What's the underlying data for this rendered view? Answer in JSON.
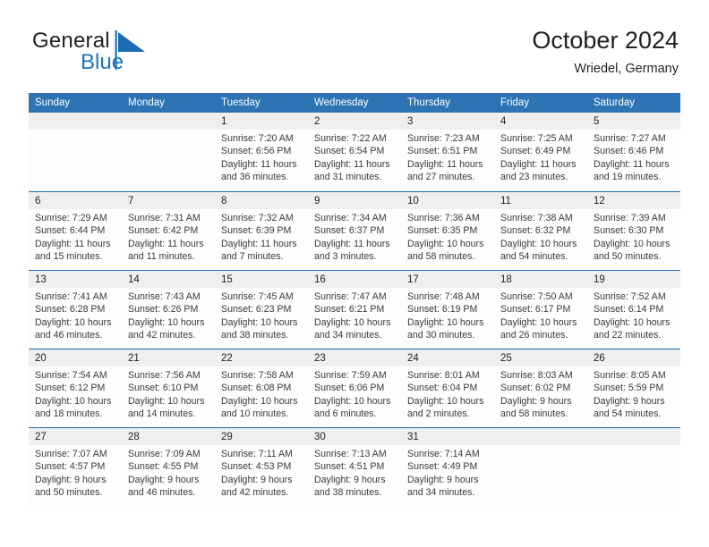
{
  "brand": {
    "name_part1": "General",
    "name_part2": "Blue",
    "logo_icon": "triangle-mark",
    "accent_color": "#1b75bb"
  },
  "header": {
    "title": "October 2024",
    "subtitle": "Wriedel, Germany"
  },
  "calendar": {
    "header_color": "#2e74b5",
    "row_divider_color": "#1f6cb0",
    "date_band_color": "#efefef",
    "weekdays": [
      "Sunday",
      "Monday",
      "Tuesday",
      "Wednesday",
      "Thursday",
      "Friday",
      "Saturday"
    ],
    "weeks": [
      [
        {
          "day": "",
          "empty": true,
          "sunrise": "",
          "sunset": "",
          "daylight_1": "",
          "daylight_2": ""
        },
        {
          "day": "",
          "empty": true,
          "sunrise": "",
          "sunset": "",
          "daylight_1": "",
          "daylight_2": ""
        },
        {
          "day": "1",
          "empty": false,
          "sunrise": "Sunrise: 7:20 AM",
          "sunset": "Sunset: 6:56 PM",
          "daylight_1": "Daylight: 11 hours",
          "daylight_2": "and 36 minutes."
        },
        {
          "day": "2",
          "empty": false,
          "sunrise": "Sunrise: 7:22 AM",
          "sunset": "Sunset: 6:54 PM",
          "daylight_1": "Daylight: 11 hours",
          "daylight_2": "and 31 minutes."
        },
        {
          "day": "3",
          "empty": false,
          "sunrise": "Sunrise: 7:23 AM",
          "sunset": "Sunset: 6:51 PM",
          "daylight_1": "Daylight: 11 hours",
          "daylight_2": "and 27 minutes."
        },
        {
          "day": "4",
          "empty": false,
          "sunrise": "Sunrise: 7:25 AM",
          "sunset": "Sunset: 6:49 PM",
          "daylight_1": "Daylight: 11 hours",
          "daylight_2": "and 23 minutes."
        },
        {
          "day": "5",
          "empty": false,
          "sunrise": "Sunrise: 7:27 AM",
          "sunset": "Sunset: 6:46 PM",
          "daylight_1": "Daylight: 11 hours",
          "daylight_2": "and 19 minutes."
        }
      ],
      [
        {
          "day": "6",
          "empty": false,
          "sunrise": "Sunrise: 7:29 AM",
          "sunset": "Sunset: 6:44 PM",
          "daylight_1": "Daylight: 11 hours",
          "daylight_2": "and 15 minutes."
        },
        {
          "day": "7",
          "empty": false,
          "sunrise": "Sunrise: 7:31 AM",
          "sunset": "Sunset: 6:42 PM",
          "daylight_1": "Daylight: 11 hours",
          "daylight_2": "and 11 minutes."
        },
        {
          "day": "8",
          "empty": false,
          "sunrise": "Sunrise: 7:32 AM",
          "sunset": "Sunset: 6:39 PM",
          "daylight_1": "Daylight: 11 hours",
          "daylight_2": "and 7 minutes."
        },
        {
          "day": "9",
          "empty": false,
          "sunrise": "Sunrise: 7:34 AM",
          "sunset": "Sunset: 6:37 PM",
          "daylight_1": "Daylight: 11 hours",
          "daylight_2": "and 3 minutes."
        },
        {
          "day": "10",
          "empty": false,
          "sunrise": "Sunrise: 7:36 AM",
          "sunset": "Sunset: 6:35 PM",
          "daylight_1": "Daylight: 10 hours",
          "daylight_2": "and 58 minutes."
        },
        {
          "day": "11",
          "empty": false,
          "sunrise": "Sunrise: 7:38 AM",
          "sunset": "Sunset: 6:32 PM",
          "daylight_1": "Daylight: 10 hours",
          "daylight_2": "and 54 minutes."
        },
        {
          "day": "12",
          "empty": false,
          "sunrise": "Sunrise: 7:39 AM",
          "sunset": "Sunset: 6:30 PM",
          "daylight_1": "Daylight: 10 hours",
          "daylight_2": "and 50 minutes."
        }
      ],
      [
        {
          "day": "13",
          "empty": false,
          "sunrise": "Sunrise: 7:41 AM",
          "sunset": "Sunset: 6:28 PM",
          "daylight_1": "Daylight: 10 hours",
          "daylight_2": "and 46 minutes."
        },
        {
          "day": "14",
          "empty": false,
          "sunrise": "Sunrise: 7:43 AM",
          "sunset": "Sunset: 6:26 PM",
          "daylight_1": "Daylight: 10 hours",
          "daylight_2": "and 42 minutes."
        },
        {
          "day": "15",
          "empty": false,
          "sunrise": "Sunrise: 7:45 AM",
          "sunset": "Sunset: 6:23 PM",
          "daylight_1": "Daylight: 10 hours",
          "daylight_2": "and 38 minutes."
        },
        {
          "day": "16",
          "empty": false,
          "sunrise": "Sunrise: 7:47 AM",
          "sunset": "Sunset: 6:21 PM",
          "daylight_1": "Daylight: 10 hours",
          "daylight_2": "and 34 minutes."
        },
        {
          "day": "17",
          "empty": false,
          "sunrise": "Sunrise: 7:48 AM",
          "sunset": "Sunset: 6:19 PM",
          "daylight_1": "Daylight: 10 hours",
          "daylight_2": "and 30 minutes."
        },
        {
          "day": "18",
          "empty": false,
          "sunrise": "Sunrise: 7:50 AM",
          "sunset": "Sunset: 6:17 PM",
          "daylight_1": "Daylight: 10 hours",
          "daylight_2": "and 26 minutes."
        },
        {
          "day": "19",
          "empty": false,
          "sunrise": "Sunrise: 7:52 AM",
          "sunset": "Sunset: 6:14 PM",
          "daylight_1": "Daylight: 10 hours",
          "daylight_2": "and 22 minutes."
        }
      ],
      [
        {
          "day": "20",
          "empty": false,
          "sunrise": "Sunrise: 7:54 AM",
          "sunset": "Sunset: 6:12 PM",
          "daylight_1": "Daylight: 10 hours",
          "daylight_2": "and 18 minutes."
        },
        {
          "day": "21",
          "empty": false,
          "sunrise": "Sunrise: 7:56 AM",
          "sunset": "Sunset: 6:10 PM",
          "daylight_1": "Daylight: 10 hours",
          "daylight_2": "and 14 minutes."
        },
        {
          "day": "22",
          "empty": false,
          "sunrise": "Sunrise: 7:58 AM",
          "sunset": "Sunset: 6:08 PM",
          "daylight_1": "Daylight: 10 hours",
          "daylight_2": "and 10 minutes."
        },
        {
          "day": "23",
          "empty": false,
          "sunrise": "Sunrise: 7:59 AM",
          "sunset": "Sunset: 6:06 PM",
          "daylight_1": "Daylight: 10 hours",
          "daylight_2": "and 6 minutes."
        },
        {
          "day": "24",
          "empty": false,
          "sunrise": "Sunrise: 8:01 AM",
          "sunset": "Sunset: 6:04 PM",
          "daylight_1": "Daylight: 10 hours",
          "daylight_2": "and 2 minutes."
        },
        {
          "day": "25",
          "empty": false,
          "sunrise": "Sunrise: 8:03 AM",
          "sunset": "Sunset: 6:02 PM",
          "daylight_1": "Daylight: 9 hours",
          "daylight_2": "and 58 minutes."
        },
        {
          "day": "26",
          "empty": false,
          "sunrise": "Sunrise: 8:05 AM",
          "sunset": "Sunset: 5:59 PM",
          "daylight_1": "Daylight: 9 hours",
          "daylight_2": "and 54 minutes."
        }
      ],
      [
        {
          "day": "27",
          "empty": false,
          "sunrise": "Sunrise: 7:07 AM",
          "sunset": "Sunset: 4:57 PM",
          "daylight_1": "Daylight: 9 hours",
          "daylight_2": "and 50 minutes."
        },
        {
          "day": "28",
          "empty": false,
          "sunrise": "Sunrise: 7:09 AM",
          "sunset": "Sunset: 4:55 PM",
          "daylight_1": "Daylight: 9 hours",
          "daylight_2": "and 46 minutes."
        },
        {
          "day": "29",
          "empty": false,
          "sunrise": "Sunrise: 7:11 AM",
          "sunset": "Sunset: 4:53 PM",
          "daylight_1": "Daylight: 9 hours",
          "daylight_2": "and 42 minutes."
        },
        {
          "day": "30",
          "empty": false,
          "sunrise": "Sunrise: 7:13 AM",
          "sunset": "Sunset: 4:51 PM",
          "daylight_1": "Daylight: 9 hours",
          "daylight_2": "and 38 minutes."
        },
        {
          "day": "31",
          "empty": false,
          "sunrise": "Sunrise: 7:14 AM",
          "sunset": "Sunset: 4:49 PM",
          "daylight_1": "Daylight: 9 hours",
          "daylight_2": "and 34 minutes."
        },
        {
          "day": "",
          "empty": true,
          "sunrise": "",
          "sunset": "",
          "daylight_1": "",
          "daylight_2": ""
        },
        {
          "day": "",
          "empty": true,
          "sunrise": "",
          "sunset": "",
          "daylight_1": "",
          "daylight_2": ""
        }
      ]
    ]
  }
}
